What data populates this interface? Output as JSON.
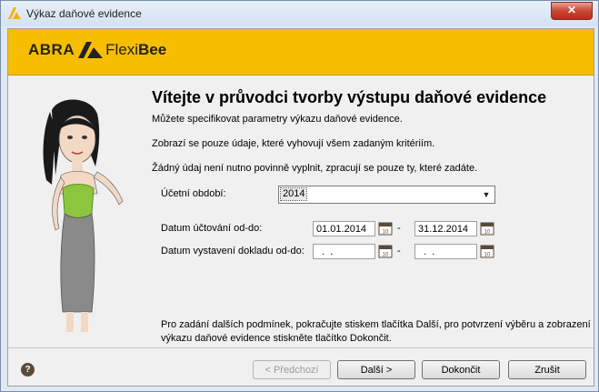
{
  "window": {
    "title": "Výkaz daňové evidence",
    "close_label": "✕"
  },
  "banner": {
    "brand_abra": "ABRA",
    "brand_flexi": "Flexi",
    "brand_bee": "Bee"
  },
  "wizard": {
    "heading": "Vítejte v průvodci tvorby výstupu daňové evidence",
    "intro1": "Můžete specifikovat parametry výkazu daňové evidence.",
    "intro2": "Zobrazí se pouze údaje, které vyhovují všem zadaným kritériím.",
    "intro3": "Žádný údaj není nutno povinně vyplnit, zpracují se pouze ty, které zadáte.",
    "period_label": "Účetní období:",
    "period_value": "2014",
    "posting_date_label": "Datum účtování od-do:",
    "posting_from": "01.01.2014",
    "posting_to": "31.12.2014",
    "issue_date_label": "Datum vystavení dokladu od-do:",
    "issue_from": "  .  .",
    "issue_to": "  .  .",
    "dash": "-",
    "footer1": "Pro zadání dalších podmínek, pokračujte stiskem tlačítka Další, pro potvrzení výběru a zobrazení",
    "footer2": "výkazu daňové evidence stiskněte tlačítko Dokončit."
  },
  "buttons": {
    "help": "?",
    "back": "< Předchozí",
    "next": "Další >",
    "finish": "Dokončit",
    "cancel": "Zrušit"
  },
  "colors": {
    "banner": "#f7bd00",
    "dialog_bg": "#f0f0f0",
    "dress_green": "#8cc63f"
  },
  "icons": {
    "calendar": "calendar-icon",
    "help": "help-icon",
    "dropdown": "chevron-down-icon"
  }
}
